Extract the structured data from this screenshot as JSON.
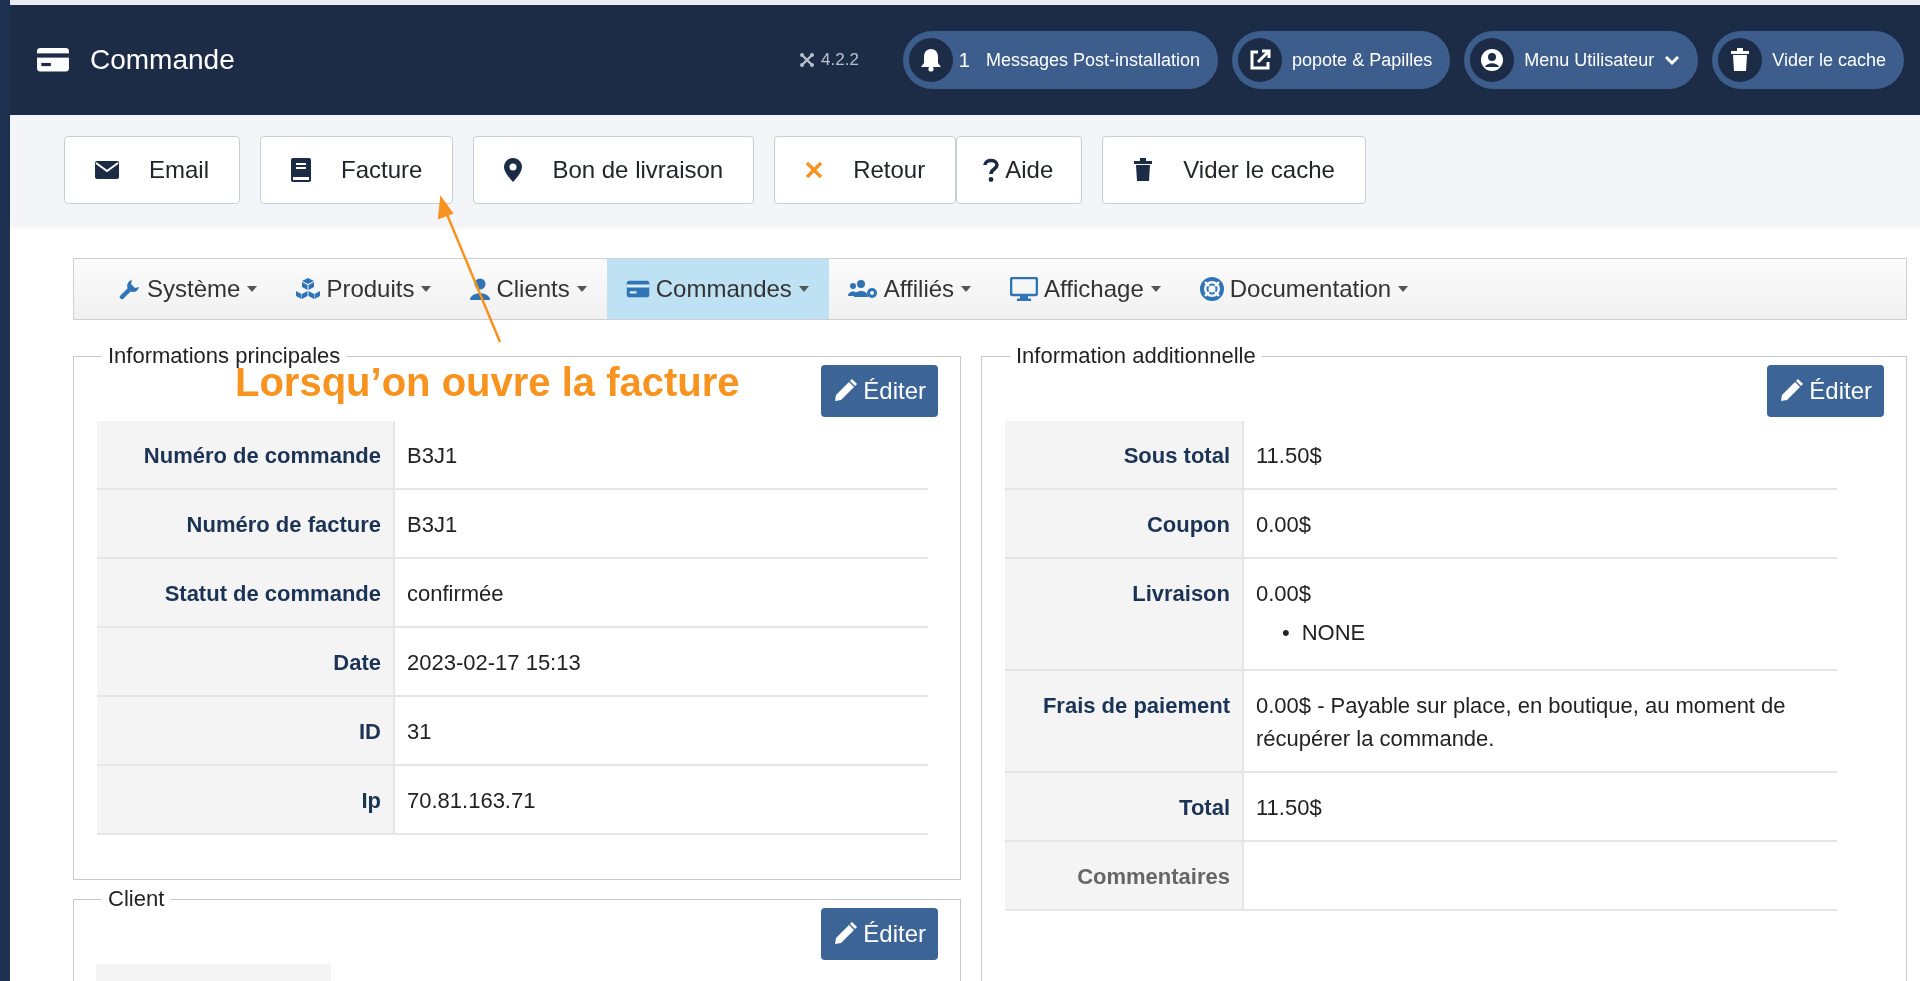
{
  "header": {
    "title": "Commande",
    "version": "4.2.2",
    "pills": [
      {
        "kind": "messages",
        "count": "1",
        "label": "Messages Post-installation"
      },
      {
        "kind": "site",
        "label": "popote & Papilles"
      },
      {
        "kind": "user",
        "label": "Menu Utilisateur"
      },
      {
        "kind": "cache",
        "label": "Vider le cache"
      }
    ]
  },
  "toolbar": [
    {
      "kind": "email",
      "label": "Email"
    },
    {
      "kind": "invoice",
      "label": "Facture"
    },
    {
      "kind": "delivery",
      "label": "Bon de livraison"
    },
    {
      "kind": "back",
      "label": "Retour"
    },
    {
      "kind": "help",
      "label": "Aide"
    },
    {
      "kind": "cache",
      "label": "Vider le cache"
    }
  ],
  "menu": [
    {
      "kind": "system",
      "label": "Système",
      "selected": false
    },
    {
      "kind": "products",
      "label": "Produits",
      "selected": false
    },
    {
      "kind": "clients",
      "label": "Clients",
      "selected": false
    },
    {
      "kind": "orders",
      "label": "Commandes",
      "selected": true
    },
    {
      "kind": "affiliates",
      "label": "Affiliés",
      "selected": false
    },
    {
      "kind": "display",
      "label": "Affichage",
      "selected": false
    },
    {
      "kind": "docs",
      "label": "Documentation",
      "selected": false
    }
  ],
  "annotation": {
    "text": "Lorsqu’on ouvre la facture"
  },
  "panels": [
    {
      "legend": "Informations principales",
      "edit_label": "Éditer",
      "rows": [
        {
          "label": "Numéro de commande",
          "value": "B3J1",
          "muted": false
        },
        {
          "label": "Numéro de facture",
          "value": "B3J1",
          "muted": false
        },
        {
          "label": "Statut de commande",
          "value": "confirmée",
          "muted": false
        },
        {
          "label": "Date",
          "value": "2023-02-17 15:13",
          "muted": false
        },
        {
          "label": "ID",
          "value": "31",
          "muted": false
        },
        {
          "label": "Ip",
          "value": "70.81.163.71",
          "muted": false
        }
      ]
    },
    {
      "legend": "Client",
      "edit_label": "Éditer"
    },
    {
      "legend": "Information additionnelle",
      "edit_label": "Éditer",
      "rows": [
        {
          "label": "Sous total",
          "value": "11.50$",
          "muted": false
        },
        {
          "label": "Coupon",
          "value": "0.00$",
          "muted": false
        },
        {
          "label": "Livraison",
          "value": "0.00$",
          "items": [
            {
              "marker": "•",
              "text": "NONE"
            }
          ],
          "muted": false
        },
        {
          "label": "Frais de paiement",
          "value": "0.00$ - Payable sur place, en boutique, au moment de récupérer la commande.",
          "muted": false
        },
        {
          "label": "Total",
          "value": "11.50$",
          "muted": false
        },
        {
          "label": "Commentaires",
          "muted": true
        }
      ]
    }
  ]
}
